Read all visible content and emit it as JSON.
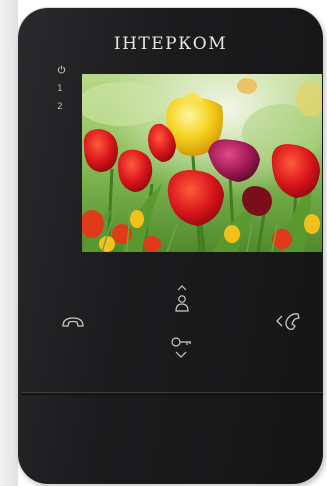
{
  "brand": "IНТЕРКОМ",
  "indicators": [
    "1",
    "2"
  ],
  "power_icon": "power-icon",
  "buttons": {
    "monitor": "person-icon",
    "hangup": "phone-hangup-icon",
    "answer": "phone-answer-icon",
    "unlock": "key-icon"
  },
  "colors": {
    "body": "#1b1b1d",
    "icon": "#c9c9c9"
  }
}
